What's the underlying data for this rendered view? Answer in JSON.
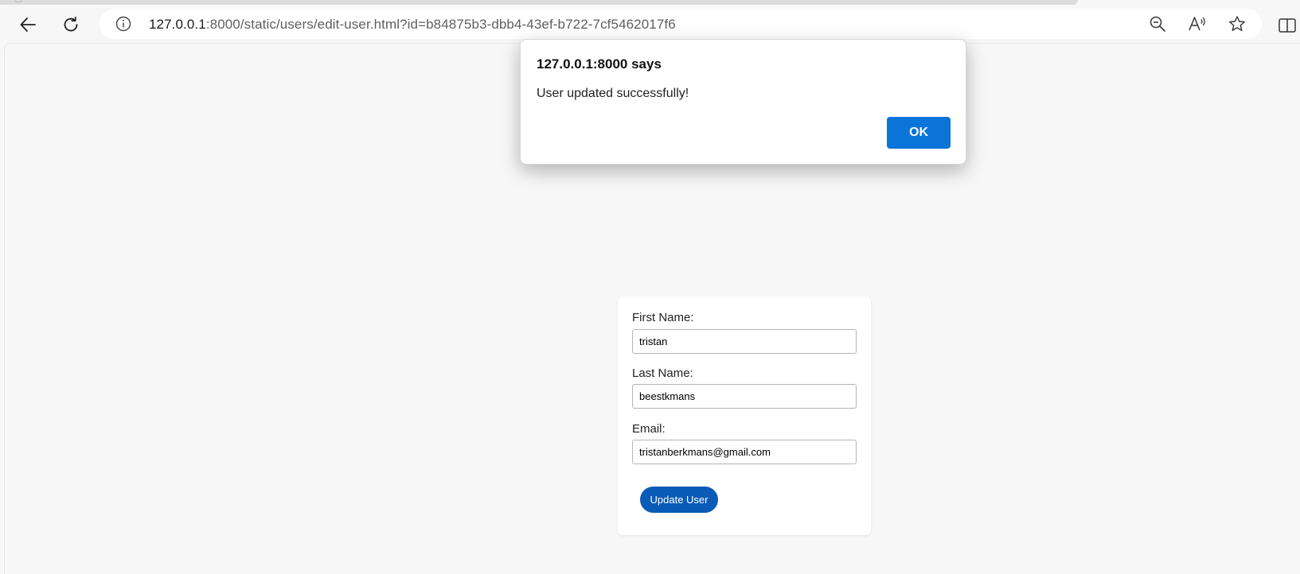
{
  "browser": {
    "url_host": "127.0.0.1",
    "url_rest": ":8000/static/users/edit-user.html?id=b84875b3-dbb4-43ef-b722-7cf5462017f6",
    "icons": {
      "back": "arrow-left-icon",
      "reload": "reload-icon",
      "info": "info-icon",
      "zoom": "zoom-out-icon",
      "read_aloud": "read-aloud-icon",
      "favorite": "star-icon",
      "split": "split-screen-icon"
    }
  },
  "form": {
    "first_name_label": "First Name:",
    "first_name_value": "tristan",
    "last_name_label": "Last Name:",
    "last_name_value": "beestkmans",
    "email_label": "Email:",
    "email_value": "tristanberkmans@gmail.com",
    "submit_label": "Update User"
  },
  "dialog": {
    "title": "127.0.0.1:8000 says",
    "message": "User updated successfully!",
    "ok_label": "OK"
  },
  "colors": {
    "page_bg": "#f7f7f7",
    "primary_button": "#0a5bb8",
    "dialog_ok": "#0b74d9"
  }
}
